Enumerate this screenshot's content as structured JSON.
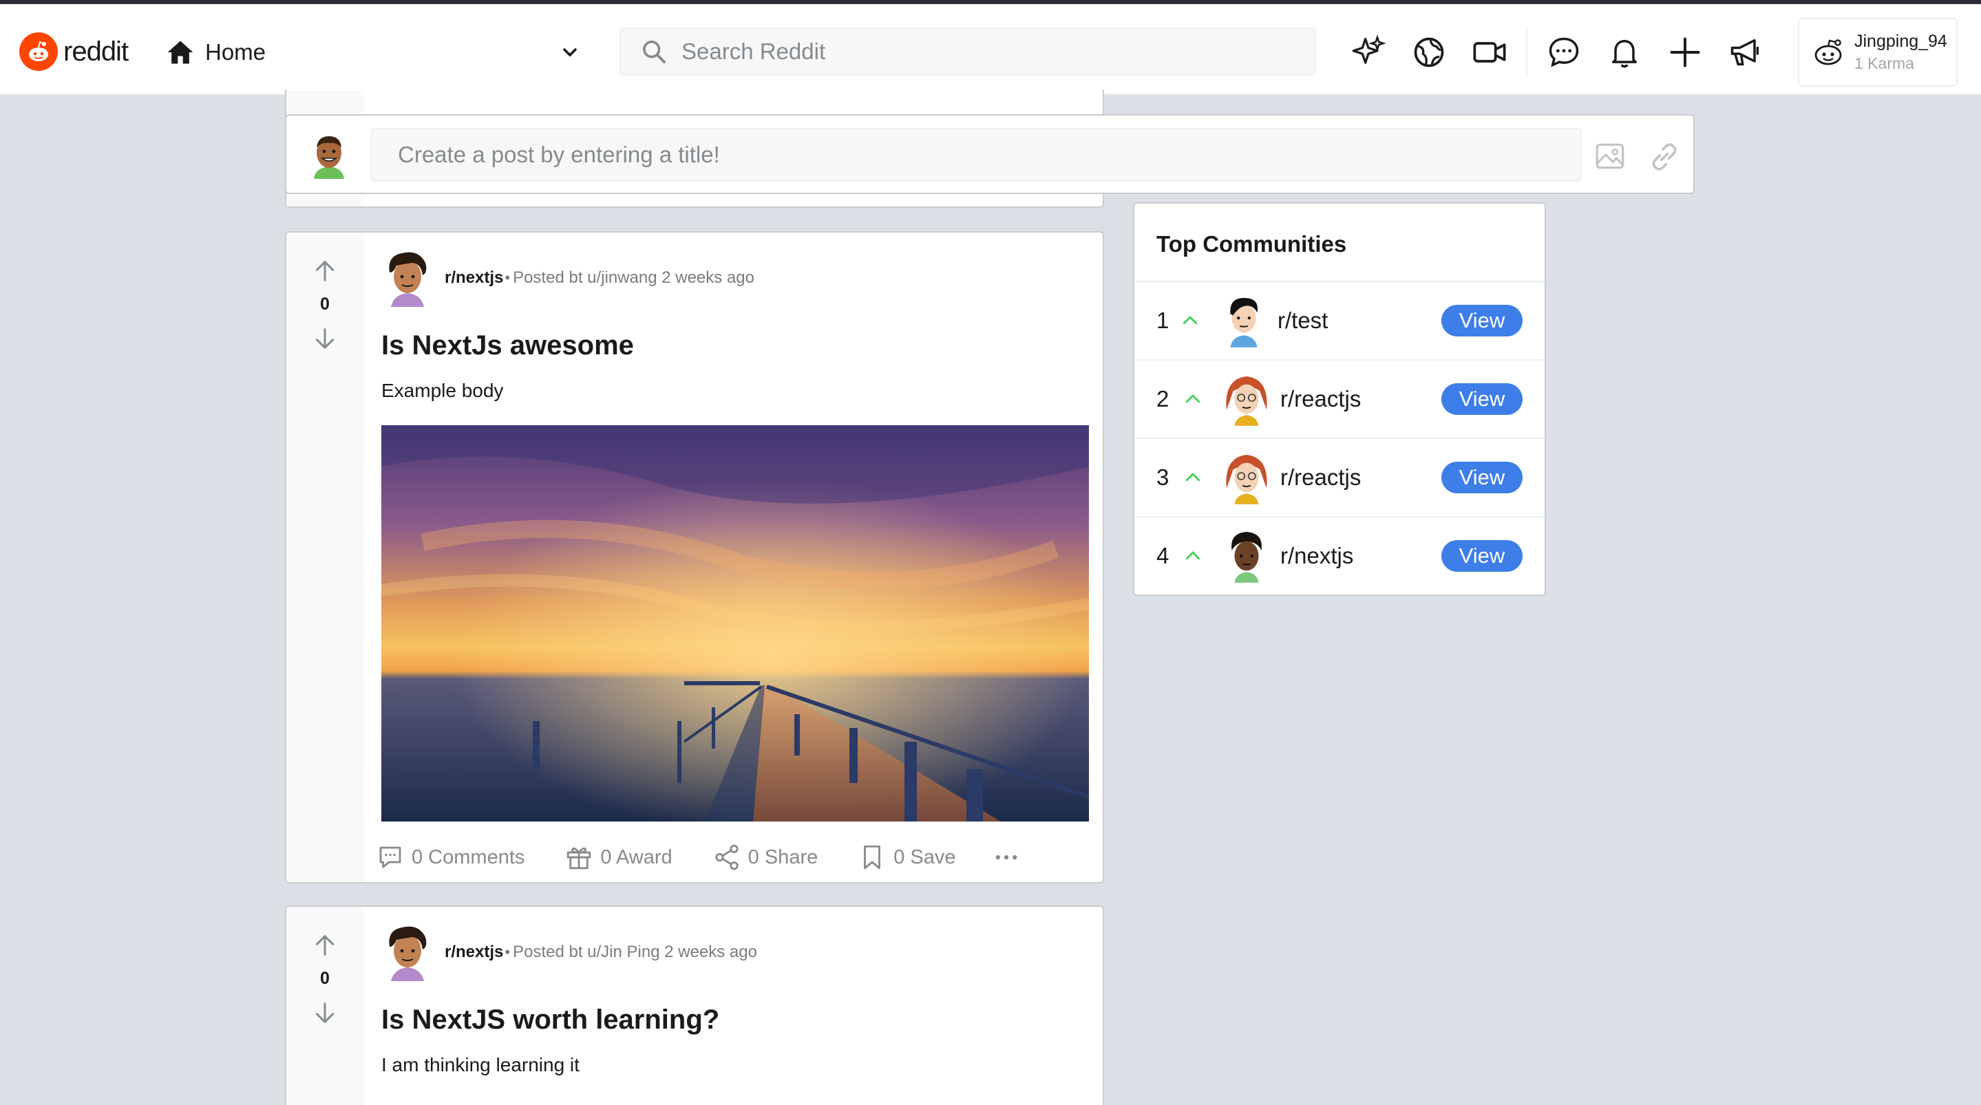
{
  "header": {
    "logo_text": "reddit",
    "home_label": "Home",
    "search_placeholder": "Search Reddit",
    "icons": [
      "sparkle-icon",
      "globe-icon",
      "video-icon",
      "chat-icon",
      "bell-icon",
      "plus-icon",
      "megaphone-icon"
    ],
    "user": {
      "name": "Jingping_94",
      "karma": "1 Karma"
    }
  },
  "create_post": {
    "placeholder": "Create a post by entering a title!"
  },
  "posts": [
    {
      "score": "0",
      "subreddit": "r/nextjs",
      "dot": "•",
      "byline": "Posted bt u/jinwang 2 weeks ago",
      "title": "Is NextJs awesome",
      "body": "Example body",
      "has_image": true,
      "actions": {
        "comments": "0 Comments",
        "award": "0 Award",
        "share": "0 Share",
        "save": "0 Save"
      }
    },
    {
      "score": "0",
      "subreddit": "r/nextjs",
      "dot": "•",
      "byline": "Posted bt u/Jin Ping 2 weeks ago",
      "title": "Is NextJS worth learning?",
      "body": "I am thinking learning it"
    }
  ],
  "sidebar": {
    "title": "Top Communities",
    "communities": [
      {
        "rank": "1",
        "name": "r/test",
        "button": "View"
      },
      {
        "rank": "2",
        "name": "r/reactjs",
        "button": "View"
      },
      {
        "rank": "3",
        "name": "r/reactjs",
        "button": "View"
      },
      {
        "rank": "4",
        "name": "r/nextjs",
        "button": "View"
      }
    ]
  },
  "colors": {
    "brand": "#ff4500",
    "accent": "#3d7ee8",
    "trend_up": "#46d160",
    "background": "#dae0e6"
  }
}
